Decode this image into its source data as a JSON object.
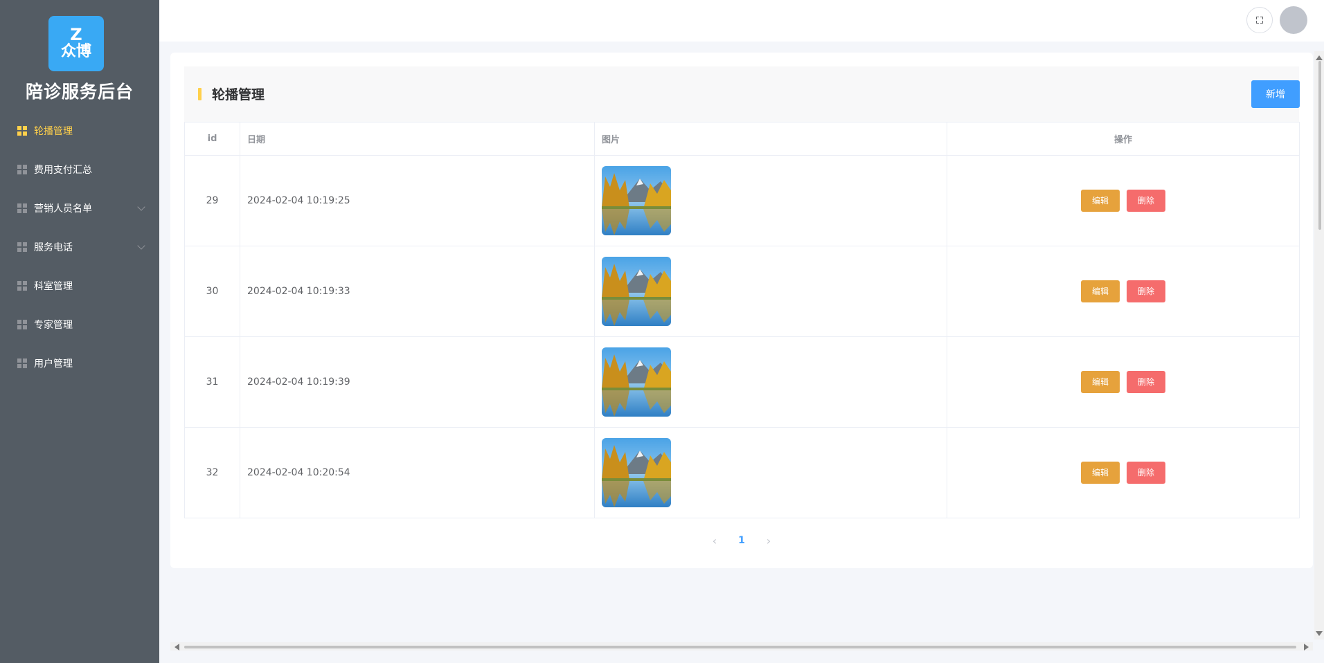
{
  "brand": {
    "logo_letter": "Z",
    "logo_text": "众博",
    "app_title": "陪诊服务后台"
  },
  "sidebar": {
    "items": [
      {
        "label": "轮播管理",
        "active": true
      },
      {
        "label": "费用支付汇总"
      },
      {
        "label": "营销人员名单",
        "expandable": true
      },
      {
        "label": "服务电话",
        "expandable": true
      },
      {
        "label": "科室管理"
      },
      {
        "label": "专家管理"
      },
      {
        "label": "用户管理"
      }
    ]
  },
  "header": {
    "fullscreen_icon": "fullscreen-icon",
    "avatar": "user-avatar"
  },
  "page": {
    "title": "轮播管理",
    "add_label": "新增"
  },
  "table": {
    "columns": [
      "id",
      "日期",
      "图片",
      "操作"
    ],
    "rows": [
      {
        "id": "29",
        "date": "2024-02-04 10:19:25",
        "image": "mountain-lake-thumbnail"
      },
      {
        "id": "30",
        "date": "2024-02-04 10:19:33",
        "image": "mountain-lake-thumbnail"
      },
      {
        "id": "31",
        "date": "2024-02-04 10:19:39",
        "image": "mountain-lake-thumbnail"
      },
      {
        "id": "32",
        "date": "2024-02-04 10:20:54",
        "image": "mountain-lake-thumbnail"
      }
    ],
    "edit_label": "编辑",
    "delete_label": "删除"
  },
  "pagination": {
    "current_page": "1",
    "prev_icon": "chevron-left-icon",
    "next_icon": "chevron-right-icon"
  },
  "colors": {
    "sidebar": "#545c64",
    "active": "#ffd04b",
    "primary": "#409eff",
    "warning": "#e6a23c",
    "danger": "#f56c6c"
  }
}
